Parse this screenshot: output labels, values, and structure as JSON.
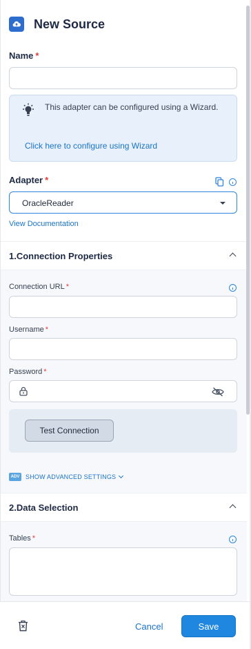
{
  "header": {
    "title": "New Source",
    "icon": "cloud-upload-icon"
  },
  "name_field": {
    "label": "Name",
    "required": "*",
    "value": "",
    "placeholder": ""
  },
  "wizard": {
    "text": "This adapter can be configured using a Wizard.",
    "link": "Click here to configure using Wizard",
    "icon": "lightbulb-icon"
  },
  "adapter": {
    "label": "Adapter",
    "required": "*",
    "selected": "OracleReader",
    "doc_link": "View Documentation"
  },
  "connection": {
    "title": "1.Connection Properties",
    "url_label": "Connection URL",
    "username_label": "Username",
    "password_label": "Password",
    "required": "*",
    "test_button": "Test Connection",
    "advanced_badge": "ADV",
    "advanced_link": "SHOW ADVANCED SETTINGS"
  },
  "data_selection": {
    "title": "2.Data Selection",
    "tables_label": "Tables",
    "required": "*"
  },
  "footer": {
    "cancel": "Cancel",
    "save": "Save"
  },
  "colors": {
    "accent": "#1f87e0",
    "link": "#1a73c9",
    "required": "#e23b3b",
    "header_icon_bg": "#2d6dcd"
  }
}
